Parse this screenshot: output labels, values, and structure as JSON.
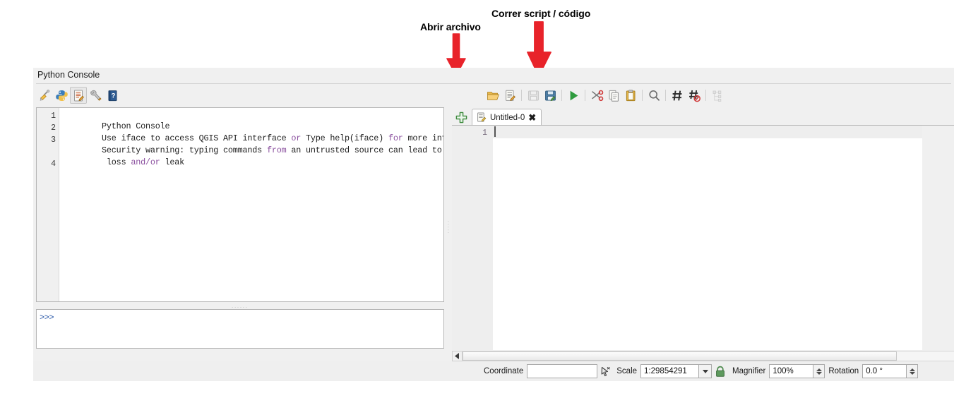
{
  "annotations": [
    {
      "text": "Abrir archivo",
      "target": "open-file-toolbar-button"
    },
    {
      "text": "Correr script / código",
      "target": "run-script-toolbar-button"
    }
  ],
  "dock": {
    "title": "Python Console"
  },
  "console_toolbar": {
    "buttons": [
      {
        "name": "clear-console-button",
        "label": "Clear Console",
        "icon": "broom-icon"
      },
      {
        "name": "run-command-button",
        "label": "Run Command",
        "icon": "python-icon"
      },
      {
        "name": "show-editor-button",
        "label": "Show Editor",
        "icon": "editor-icon",
        "active": true
      },
      {
        "name": "options-button",
        "label": "Options",
        "icon": "wrench-icon"
      },
      {
        "name": "help-button",
        "label": "Help",
        "icon": "help-book-icon"
      }
    ]
  },
  "editor_toolbar": {
    "buttons": [
      {
        "name": "open-file-button",
        "label": "Open Script",
        "icon": "open-folder-icon"
      },
      {
        "name": "new-script-button",
        "label": "New Script",
        "icon": "new-document-icon"
      },
      {
        "name": "save-button",
        "label": "Save",
        "icon": "floppy-disk-icon",
        "disabled": true
      },
      {
        "name": "save-as-button",
        "label": "Save As",
        "icon": "floppy-save-as-icon"
      },
      {
        "name": "run-script-button",
        "label": "Run Script",
        "icon": "play-triangle-icon"
      },
      {
        "name": "cut-button",
        "label": "Cut",
        "icon": "scissors-icon"
      },
      {
        "name": "copy-button",
        "label": "Copy",
        "icon": "copy-icon"
      },
      {
        "name": "paste-button",
        "label": "Paste",
        "icon": "clipboard-icon"
      },
      {
        "name": "find-button",
        "label": "Find Text",
        "icon": "magnifier-icon"
      },
      {
        "name": "comment-button",
        "label": "Comment",
        "icon": "hash-icon"
      },
      {
        "name": "uncomment-button",
        "label": "Uncomment",
        "icon": "hash-strike-icon"
      },
      {
        "name": "object-inspector-button",
        "label": "Object Inspector",
        "icon": "tree-icon",
        "disabled": true
      }
    ]
  },
  "console_output": {
    "lines": [
      {
        "number": "1",
        "segments": [
          {
            "t": "Python Console",
            "k": false
          }
        ]
      },
      {
        "number": "2",
        "segments": [
          {
            "t": "Use iface to access QGIS API interface ",
            "k": false
          },
          {
            "t": "or",
            "k": true
          },
          {
            "t": " Type help(iface) ",
            "k": false
          },
          {
            "t": "for",
            "k": true
          },
          {
            "t": " more info",
            "k": false
          }
        ]
      },
      {
        "number": "3",
        "segments": [
          {
            "t": "Security warning: typing commands ",
            "k": false
          },
          {
            "t": "from",
            "k": true
          },
          {
            "t": " an untrusted source can lead to data",
            "k": false
          }
        ]
      },
      {
        "number": "",
        "segments": [
          {
            "t": " loss ",
            "k": false
          },
          {
            "t": "and/or",
            "k": true
          },
          {
            "t": " leak",
            "k": false
          }
        ]
      },
      {
        "number": "4",
        "segments": [
          {
            "t": "",
            "k": false
          }
        ]
      }
    ]
  },
  "console_input": {
    "prompt": ">>>",
    "value": ""
  },
  "editor": {
    "new_tab_label": "+",
    "tabs": [
      {
        "label": "Untitled-0",
        "close": "✖",
        "active": true
      }
    ],
    "line_numbers": [
      "1"
    ],
    "content": ""
  },
  "statusbar": {
    "coordinate_label": "Coordinate",
    "coordinate_value": "",
    "toggle_extents_icon": "mouse-position-icon",
    "scale_label": "Scale",
    "scale_value": "1:29854291",
    "lock_icon": "green-padlock-icon",
    "magnifier_label": "Magnifier",
    "magnifier_value": "100%",
    "rotation_label": "Rotation",
    "rotation_value": "0.0 °"
  },
  "colors": {
    "annotation_red": "#E8232A",
    "keyword_purple": "#8A4F9E",
    "prompt_blue": "#2A58A8",
    "run_green": "#2E9B3E",
    "panel_gray": "#F0F0F0",
    "lock_green": "#4E8A4E"
  }
}
